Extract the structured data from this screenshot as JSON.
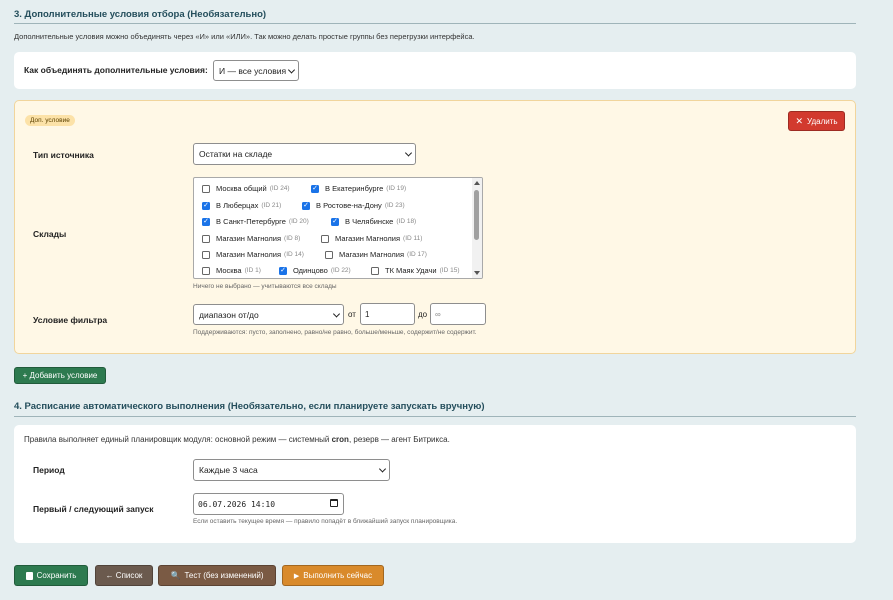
{
  "section3": {
    "title": "3. Дополнительные условия отбора (Необязательно)",
    "intro": "Дополнительные условия можно объединять через «И» или «ИЛИ». Так можно делать простые группы без перегрузки интерфейса.",
    "combine_label": "Как объединять дополнительные условия:",
    "combine_value": "И — все условия"
  },
  "condition": {
    "badge": "Доп. условие",
    "delete_label": "Удалить",
    "source_label": "Тип источника",
    "source_value": "Остатки на складе",
    "warehouses_label": "Склады",
    "warehouses": [
      {
        "name": "Москва общий",
        "id": "(ID 24)",
        "checked": false
      },
      {
        "name": "В Екатеринбурге",
        "id": "(ID 19)",
        "checked": true
      },
      {
        "name": "В Люберцах",
        "id": "(ID 21)",
        "checked": true
      },
      {
        "name": "В Ростове-на-Дону",
        "id": "(ID 23)",
        "checked": true
      },
      {
        "name": "В Санкт-Петербурге",
        "id": "(ID 20)",
        "checked": true
      },
      {
        "name": "В Челябинске",
        "id": "(ID 18)",
        "checked": true
      },
      {
        "name": "Магазин Магнолия",
        "id": "(ID 8)",
        "checked": false
      },
      {
        "name": "Магазин Магнолия",
        "id": "(ID 11)",
        "checked": false
      },
      {
        "name": "Магазин Магнолия",
        "id": "(ID 14)",
        "checked": false
      },
      {
        "name": "Магазин Магнолия",
        "id": "(ID 17)",
        "checked": false
      },
      {
        "name": "Москва",
        "id": "(ID 1)",
        "checked": false
      },
      {
        "name": "Одинцово",
        "id": "(ID 22)",
        "checked": true
      },
      {
        "name": "ТК Маяк Удачи",
        "id": "(ID 15)",
        "checked": false
      }
    ],
    "warehouses_hint": "Ничего не выбрано — учитываются все склады",
    "filter_label": "Условие фильтра",
    "filter_value": "диапазон от/до",
    "from_label": "от",
    "from_value": "1",
    "to_label": "до",
    "to_placeholder": "∞",
    "filter_hint": "Поддерживаются: пусто, заполнено, равно/не равно, больше/меньше, содержит/не содержит."
  },
  "add_condition_label": "+ Добавить условие",
  "section4": {
    "title": "4. Расписание автоматического выполнения (Необязательно, если планируете запускать вручную)",
    "intro_before": "Правила выполняет единый планировщик модуля: основной режим — системный ",
    "intro_cron": "cron",
    "intro_after": ", резерв — агент Битрикса.",
    "period_label": "Период",
    "period_value": "Каждые 3 часа",
    "run_label": "Первый / следующий запуск",
    "run_value": "06.07.2026 14:10",
    "run_hint": "Если оставить текущее время — правило попадёт в ближайший запуск планировщика."
  },
  "actions": {
    "save": "Сохранить",
    "list": "← Список",
    "test": "Тест (без изменений)",
    "run": "Выполнить сейчас"
  },
  "colors": {
    "green": "#2d7a4f",
    "brown": "#6b5a4e",
    "brown2": "#7a5a44",
    "orange": "#d98a2b",
    "red": "#d23a2e",
    "checkbox": "#1a73e8"
  }
}
